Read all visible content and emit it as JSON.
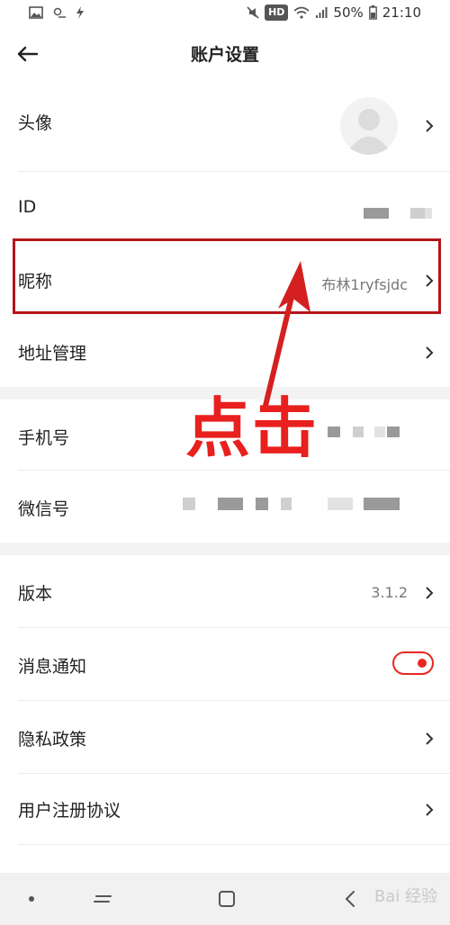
{
  "status_bar": {
    "hd": "HD",
    "battery": "50%",
    "time": "21:10"
  },
  "header": {
    "title": "账户设置"
  },
  "rows": {
    "avatar": {
      "label": "头像"
    },
    "id": {
      "label": "ID"
    },
    "nickname": {
      "label": "昵称",
      "value": "布林1ryfsjdc"
    },
    "address": {
      "label": "地址管理"
    },
    "phone": {
      "label": "手机号"
    },
    "wechat": {
      "label": "微信号"
    },
    "version": {
      "label": "版本",
      "value": "3.1.2"
    },
    "notifications": {
      "label": "消息通知",
      "toggle_on": true
    },
    "privacy": {
      "label": "隐私政策"
    },
    "user_agreement": {
      "label": "用户注册协议"
    }
  },
  "annotation": {
    "text": "点击",
    "color": "#e8201e"
  },
  "highlight_color": "#b3151a",
  "watermark": "Bai 经验"
}
